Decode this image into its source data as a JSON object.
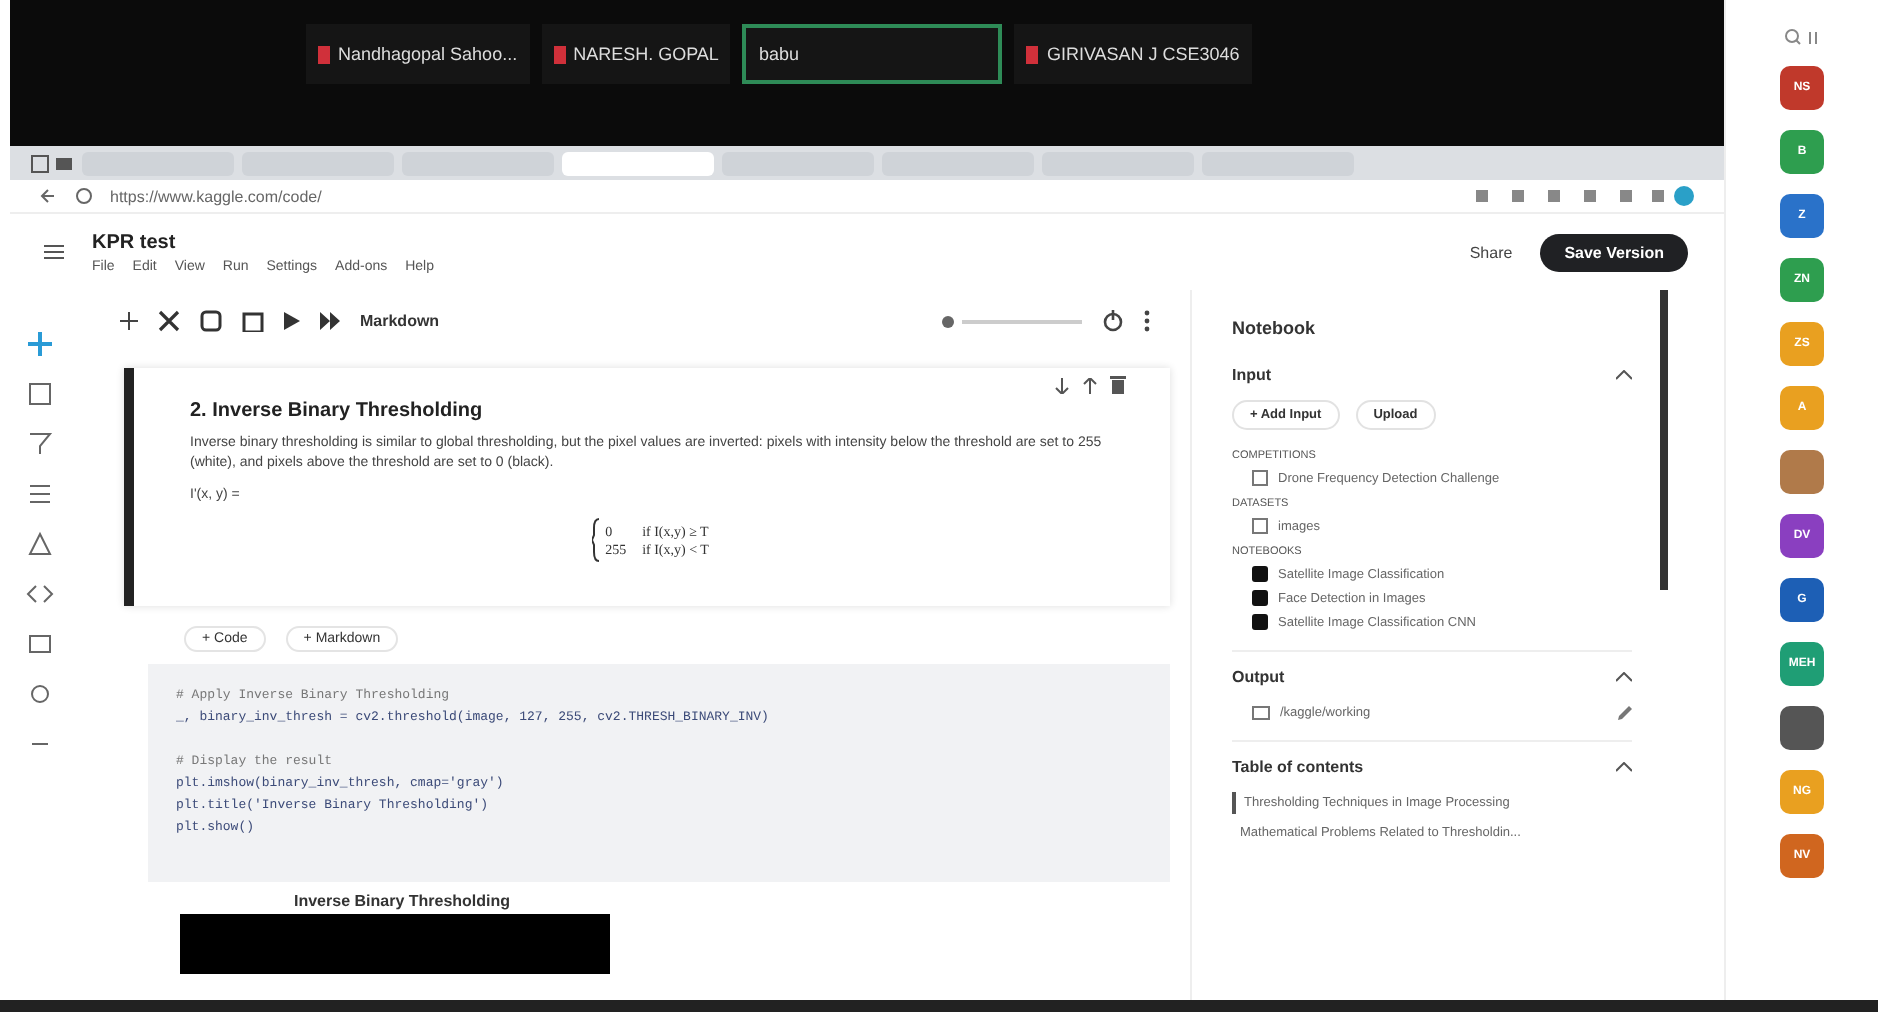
{
  "call": {
    "participants": [
      {
        "name": "Nandhagopal Sahoo...",
        "muted": true,
        "speaking": false
      },
      {
        "name": "NARESH. GOPAL",
        "muted": true,
        "speaking": false
      },
      {
        "name": "babu",
        "muted": false,
        "speaking": true
      },
      {
        "name": "GIRIVASAN J CSE3046",
        "muted": true,
        "speaking": false
      }
    ]
  },
  "browser": {
    "tabs": [
      {
        "selected": false
      },
      {
        "selected": false
      },
      {
        "selected": false
      },
      {
        "selected": true
      },
      {
        "selected": false
      },
      {
        "selected": false
      },
      {
        "selected": false
      },
      {
        "selected": false
      }
    ],
    "url": "https://www.kaggle.com/code/"
  },
  "notebook": {
    "title": "KPR test",
    "menu": [
      "File",
      "Edit",
      "View",
      "Run",
      "Settings",
      "Add-ons",
      "Help"
    ],
    "share": "Share",
    "save": "Save Version",
    "toolbar": {
      "cell_type": "Markdown"
    },
    "markdown_cell": {
      "heading": "2. Inverse Binary Thresholding",
      "text": "Inverse binary thresholding is similar to global thresholding, but the pixel values are inverted: pixels with intensity below the threshold are set to 255 (white), and pixels above the threshold are set to 0 (black).",
      "formula_lhs": "I'(x, y) =",
      "cases": [
        {
          "value": "0",
          "condition": "if I(x,y) ≥ T"
        },
        {
          "value": "255",
          "condition": "if I(x,y) < T"
        }
      ]
    },
    "add_buttons": [
      "+ Code",
      "+ Markdown"
    ],
    "code_lines": [
      {
        "kind": "comment",
        "text": "# Apply Inverse Binary Thresholding"
      },
      {
        "kind": "code",
        "text": "_, binary_inv_thresh = cv2.threshold(image, 127, 255, cv2.THRESH_BINARY_INV)"
      },
      {
        "kind": "blank"
      },
      {
        "kind": "comment",
        "text": "# Display the result"
      },
      {
        "kind": "code",
        "text": "plt.imshow(binary_inv_thresh, cmap='gray')"
      },
      {
        "kind": "code",
        "text": "plt.title('Inverse Binary Thresholding')"
      },
      {
        "kind": "code",
        "text": "plt.show()"
      }
    ],
    "output_title": "Inverse Binary Thresholding"
  },
  "side_panel": {
    "title": "Notebook",
    "input": {
      "title": "Input",
      "buttons": [
        "+ Add Input",
        "Upload"
      ],
      "groups": [
        {
          "label": "COMPETITIONS",
          "items": [
            "Drone Frequency Detection Challenge"
          ]
        },
        {
          "label": "DATASETS",
          "items": [
            "images"
          ]
        },
        {
          "label": "NOTEBOOKS",
          "items": [
            "Satellite Image Classification",
            "Face Detection in Images",
            "Satellite Image Classification CNN"
          ]
        }
      ]
    },
    "output": {
      "title": "Output",
      "items": [
        "/kaggle/working"
      ]
    },
    "toc": {
      "title": "Table of contents",
      "items": [
        "Thresholding Techniques in Image Processing",
        "Mathematical Problems Related to Thresholdin..."
      ]
    }
  },
  "people": [
    {
      "initials": "NS",
      "color": "#c0392b"
    },
    {
      "initials": "B",
      "color": "#2e9e4f"
    },
    {
      "initials": "Z",
      "color": "#2a72c9"
    },
    {
      "initials": "ZN",
      "color": "#2e9e4f"
    },
    {
      "initials": "ZS",
      "color": "#e9a020"
    },
    {
      "initials": "A",
      "color": "#e9a020"
    },
    {
      "color": "#b07a4a"
    },
    {
      "initials": "DV",
      "color": "#8a3fc0"
    },
    {
      "initials": "G",
      "color": "#1d5fb5"
    },
    {
      "initials": "MEH",
      "color": "#1f9e75"
    },
    {
      "color": "#555555"
    },
    {
      "initials": "NG",
      "color": "#e9a020"
    },
    {
      "initials": "NV",
      "color": "#d0661f"
    }
  ]
}
